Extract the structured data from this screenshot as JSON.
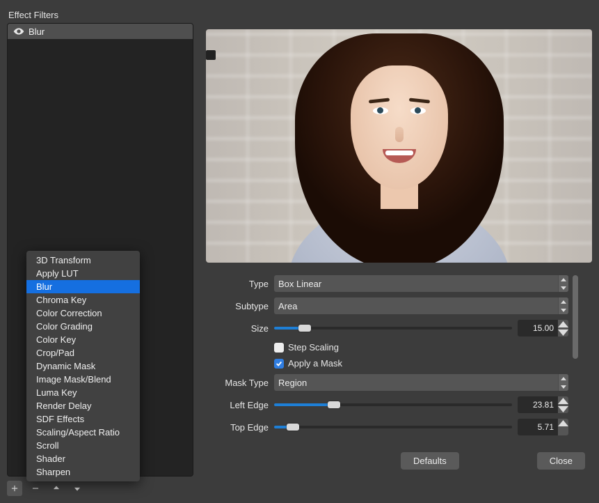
{
  "panel": {
    "title": "Effect Filters"
  },
  "filters": {
    "items": [
      {
        "name": "Blur"
      }
    ]
  },
  "popup": {
    "items": [
      "3D Transform",
      "Apply LUT",
      "Blur",
      "Chroma Key",
      "Color Correction",
      "Color Grading",
      "Color Key",
      "Crop/Pad",
      "Dynamic Mask",
      "Image Mask/Blend",
      "Luma Key",
      "Render Delay",
      "SDF Effects",
      "Scaling/Aspect Ratio",
      "Scroll",
      "Shader",
      "Sharpen"
    ],
    "selected_index": 2
  },
  "props": {
    "type": {
      "label": "Type",
      "value": "Box Linear"
    },
    "subtype": {
      "label": "Subtype",
      "value": "Area"
    },
    "size": {
      "label": "Size",
      "value": "15.00",
      "percent": 13
    },
    "step_scaling": {
      "label": "Step Scaling",
      "checked": false
    },
    "apply_mask": {
      "label": "Apply a Mask",
      "checked": true
    },
    "mask_type": {
      "label": "Mask Type",
      "value": "Region"
    },
    "left_edge": {
      "label": "Left Edge",
      "value": "23.81",
      "percent": 25
    },
    "top_edge": {
      "label": "Top Edge",
      "value": "5.71",
      "percent": 8
    }
  },
  "footer": {
    "defaults": "Defaults",
    "close": "Close"
  }
}
